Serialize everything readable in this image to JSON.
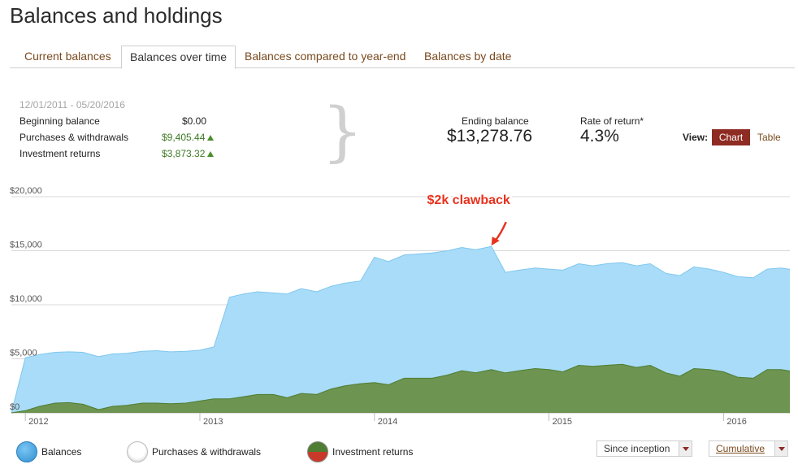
{
  "page": {
    "title": "Balances and holdings"
  },
  "tabs": [
    {
      "label": "Current balances",
      "active": false
    },
    {
      "label": "Balances over time",
      "active": true
    },
    {
      "label": "Balances compared to year-end",
      "active": false
    },
    {
      "label": "Balances by date",
      "active": false
    }
  ],
  "summary": {
    "date_range": "12/01/2011 - 05/20/2016",
    "beginning_balance_label": "Beginning balance",
    "beginning_balance_value": "$0.00",
    "purchases_label": "Purchases & withdrawals",
    "purchases_value": "$9,405.44",
    "returns_label": "Investment returns",
    "returns_value": "$3,873.32",
    "ending_balance_label": "Ending balance",
    "ending_balance_value": "$13,278.76",
    "rate_of_return_label": "Rate of return*",
    "rate_of_return_value": "4.3%"
  },
  "view": {
    "label": "View:",
    "chart_label": "Chart",
    "table_label": "Table",
    "selected": "Chart"
  },
  "annotation": {
    "text": "$2k clawback",
    "color": "#e8321e"
  },
  "colors": {
    "balances": "#a9dcf8",
    "balances_line": "#7fc7ef",
    "returns": "#6d9450",
    "returns_line": "#4f7d31",
    "accent": "#8e2b23",
    "link": "#7a4a1e",
    "positive": "#3d7a23"
  },
  "legend": [
    {
      "label": "Balances"
    },
    {
      "label": "Purchases & withdrawals"
    },
    {
      "label": "Investment returns"
    }
  ],
  "controls": {
    "range_label": "Since inception",
    "mode_label": "Cumulative"
  },
  "chart_data": {
    "type": "area",
    "x_ticks": [
      "2012",
      "2013",
      "2014",
      "2015",
      "2016"
    ],
    "y_ticks": [
      "$0",
      "$5,000",
      "$10,000",
      "$15,000",
      "$20,000"
    ],
    "ylim": [
      0,
      20000
    ],
    "xlim": [
      2011.92,
      2016.38
    ],
    "grid": true,
    "series": [
      {
        "name": "Balances",
        "points": [
          [
            2011.92,
            0
          ],
          [
            2012.0,
            5100
          ],
          [
            2012.08,
            5400
          ],
          [
            2012.17,
            5600
          ],
          [
            2012.25,
            5650
          ],
          [
            2012.33,
            5600
          ],
          [
            2012.42,
            5200
          ],
          [
            2012.5,
            5450
          ],
          [
            2012.58,
            5500
          ],
          [
            2012.67,
            5700
          ],
          [
            2012.75,
            5750
          ],
          [
            2012.83,
            5650
          ],
          [
            2012.92,
            5700
          ],
          [
            2013.0,
            5800
          ],
          [
            2013.08,
            6100
          ],
          [
            2013.17,
            10700
          ],
          [
            2013.25,
            11000
          ],
          [
            2013.33,
            11200
          ],
          [
            2013.42,
            11100
          ],
          [
            2013.5,
            11000
          ],
          [
            2013.58,
            11500
          ],
          [
            2013.67,
            11200
          ],
          [
            2013.75,
            11700
          ],
          [
            2013.83,
            12000
          ],
          [
            2013.92,
            12200
          ],
          [
            2014.0,
            14400
          ],
          [
            2014.08,
            14000
          ],
          [
            2014.17,
            14600
          ],
          [
            2014.25,
            14700
          ],
          [
            2014.33,
            14800
          ],
          [
            2014.42,
            15000
          ],
          [
            2014.5,
            15300
          ],
          [
            2014.58,
            15100
          ],
          [
            2014.67,
            15400
          ],
          [
            2014.75,
            13000
          ],
          [
            2014.83,
            13200
          ],
          [
            2014.92,
            13400
          ],
          [
            2015.0,
            13300
          ],
          [
            2015.08,
            13200
          ],
          [
            2015.17,
            13800
          ],
          [
            2015.25,
            13600
          ],
          [
            2015.33,
            13800
          ],
          [
            2015.42,
            13900
          ],
          [
            2015.5,
            13600
          ],
          [
            2015.58,
            13800
          ],
          [
            2015.67,
            12900
          ],
          [
            2015.75,
            12700
          ],
          [
            2015.83,
            13500
          ],
          [
            2015.92,
            13300
          ],
          [
            2016.0,
            13000
          ],
          [
            2016.08,
            12600
          ],
          [
            2016.17,
            12500
          ],
          [
            2016.25,
            13300
          ],
          [
            2016.33,
            13400
          ],
          [
            2016.38,
            13279
          ]
        ]
      },
      {
        "name": "Investment returns",
        "points": [
          [
            2011.92,
            0
          ],
          [
            2012.0,
            200
          ],
          [
            2012.08,
            600
          ],
          [
            2012.17,
            900
          ],
          [
            2012.25,
            950
          ],
          [
            2012.33,
            800
          ],
          [
            2012.42,
            300
          ],
          [
            2012.5,
            600
          ],
          [
            2012.58,
            700
          ],
          [
            2012.67,
            900
          ],
          [
            2012.75,
            900
          ],
          [
            2012.83,
            850
          ],
          [
            2012.92,
            900
          ],
          [
            2013.0,
            1100
          ],
          [
            2013.08,
            1300
          ],
          [
            2013.17,
            1300
          ],
          [
            2013.25,
            1500
          ],
          [
            2013.33,
            1700
          ],
          [
            2013.42,
            1700
          ],
          [
            2013.5,
            1400
          ],
          [
            2013.58,
            1800
          ],
          [
            2013.67,
            1700
          ],
          [
            2013.75,
            2200
          ],
          [
            2013.83,
            2500
          ],
          [
            2013.92,
            2700
          ],
          [
            2014.0,
            2800
          ],
          [
            2014.08,
            2600
          ],
          [
            2014.17,
            3200
          ],
          [
            2014.25,
            3200
          ],
          [
            2014.33,
            3200
          ],
          [
            2014.42,
            3500
          ],
          [
            2014.5,
            3900
          ],
          [
            2014.58,
            3700
          ],
          [
            2014.67,
            4000
          ],
          [
            2014.75,
            3700
          ],
          [
            2014.83,
            3900
          ],
          [
            2014.92,
            4100
          ],
          [
            2015.0,
            4000
          ],
          [
            2015.08,
            3800
          ],
          [
            2015.17,
            4400
          ],
          [
            2015.25,
            4300
          ],
          [
            2015.33,
            4400
          ],
          [
            2015.42,
            4500
          ],
          [
            2015.5,
            4200
          ],
          [
            2015.58,
            4400
          ],
          [
            2015.67,
            3700
          ],
          [
            2015.75,
            3400
          ],
          [
            2015.83,
            4100
          ],
          [
            2015.92,
            4000
          ],
          [
            2016.0,
            3800
          ],
          [
            2016.08,
            3300
          ],
          [
            2016.17,
            3200
          ],
          [
            2016.25,
            4000
          ],
          [
            2016.33,
            4000
          ],
          [
            2016.38,
            3873
          ]
        ]
      }
    ],
    "annotation_point": [
      2014.67,
      15400
    ]
  }
}
